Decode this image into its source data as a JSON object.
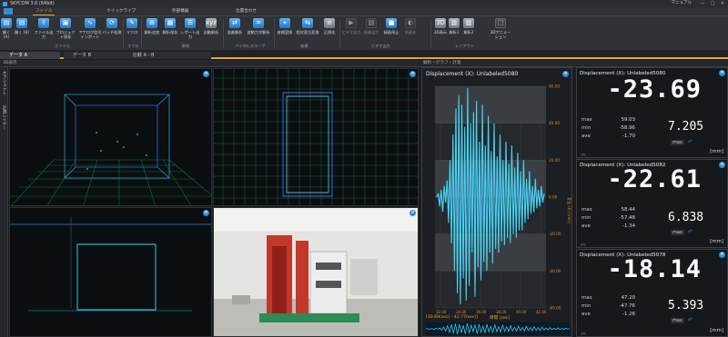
{
  "window": {
    "title": "SKYCOM 3.6 (64bit)",
    "right_label": "マニュアル",
    "min": "—",
    "max": "□",
    "close": "✕"
  },
  "ribbon_tabs": [
    {
      "label": "ファイル",
      "active": true
    },
    {
      "label": "クイックライブ",
      "active": false
    },
    {
      "label": "外部機器",
      "active": false
    },
    {
      "label": "位置合わせ",
      "active": false
    }
  ],
  "ribbon": {
    "buttons": [
      {
        "label": "開く (A)",
        "icon": "folder-icon"
      },
      {
        "label": "開く (B)",
        "icon": "folder-icon"
      },
      {
        "label": "ファイル出力",
        "icon": "export-icon"
      },
      {
        "label": "プロジェクト保存",
        "icon": "save-icon"
      },
      {
        "label": "アナログ信号インポート",
        "icon": "import-icon"
      },
      {
        "label": "バッチ処理",
        "icon": "batch-icon"
      },
      {
        "label": "マクロ",
        "icon": "macro-icon"
      },
      {
        "label": "解析追加",
        "icon": "add-analysis-icon"
      },
      {
        "label": "解析保存",
        "icon": "save-analysis-icon"
      },
      {
        "label": "レポート出力",
        "icon": "report-icon"
      },
      {
        "label": "自動解析",
        "icon": "auto-analysis-icon"
      },
      {
        "label": "並進解析",
        "icon": "translation-icon"
      },
      {
        "label": "波動力学解析",
        "icon": "wave-icon"
      },
      {
        "label": "座標変換",
        "icon": "coordinate-icon"
      },
      {
        "label": "相対変位変換",
        "icon": "relative-icon"
      },
      {
        "label": "正規化",
        "icon": "normalize-icon"
      },
      {
        "label": "ビデオ出力",
        "icon": "video-out-icon"
      },
      {
        "label": "画像出力",
        "icon": "image-out-icon"
      },
      {
        "label": "録画停止",
        "icon": "record-stop-icon"
      },
      {
        "label": "低速化",
        "icon": "slow-icon"
      },
      {
        "label": "3D表示",
        "icon": "3d-icon"
      },
      {
        "label": "解析1",
        "icon": "layout-1-icon"
      },
      {
        "label": "解析2",
        "icon": "layout-2-icon"
      },
      {
        "label": "3Dアニメーション",
        "icon": "3d-animation-icon"
      }
    ],
    "groups": [
      "ファイル",
      "マクロ",
      "解析",
      "バイタルスコープ",
      "座標",
      "ビデオ出力",
      "レイアウト"
    ]
  },
  "doc_tabs": [
    {
      "label": "データ A",
      "active": true
    },
    {
      "label": "データ B",
      "active": false
    },
    {
      "label": "比較 A・B",
      "active": false
    }
  ],
  "subheader": {
    "left": "3D表示",
    "right": "解析・グラフ・計測"
  },
  "side_strip": {
    "items": [
      "オブジェクト",
      "計測レイヤー"
    ]
  },
  "chart_data": {
    "type": "line",
    "title": "Displacement (X): Unlabeled5080",
    "ylabel": "変位 (X) [mm]",
    "xlabel": "時間 [sec]",
    "ylim": [
      -60,
      60
    ],
    "xlim": [
      32,
      43
    ],
    "y_ticks": [
      "60.00",
      "40.00",
      "20.00",
      "0.00",
      "-20.00",
      "-40.00",
      "-60.00"
    ],
    "x_ticks": [
      "32.00",
      "34.00",
      "36.00",
      "38.00",
      "40.00",
      "42.00"
    ],
    "cursor_text": "[30.69(sec) - 42.77(sec)]",
    "series": [
      {
        "color": "#3fd8ee",
        "values": [
          0,
          2,
          -5,
          4,
          -8,
          6,
          -3,
          9,
          -14,
          20,
          -25,
          34,
          -40,
          48,
          -52,
          55,
          -58,
          50,
          -44,
          38,
          -56,
          59,
          -48,
          40,
          -30,
          46,
          -54,
          52,
          -38,
          30,
          -45,
          50,
          -35,
          28,
          -40,
          44,
          -30,
          25,
          -36,
          40,
          -28,
          22,
          -30,
          34,
          -24,
          20,
          -26,
          30,
          -22,
          18,
          -25,
          28,
          -20,
          16,
          -22,
          24,
          -18,
          14,
          -18,
          20,
          -14,
          10,
          -12,
          14,
          -9,
          6,
          -8,
          10,
          -6,
          4,
          -5,
          6,
          -3,
          2
        ]
      },
      {
        "color": "#9a3ae0",
        "values": [
          0,
          1,
          -4,
          3,
          -7,
          5,
          -2,
          8,
          -12,
          18,
          -22,
          31,
          -37,
          45,
          -49,
          52,
          -55,
          47,
          -41,
          35,
          -53,
          56,
          -45,
          37,
          -27,
          43,
          -51,
          49,
          -35,
          27,
          -42,
          47,
          -32,
          25,
          -37,
          41,
          -27,
          22,
          -33,
          37,
          -25,
          19,
          -27,
          31,
          -21,
          17,
          -23,
          27,
          -19,
          15,
          -22,
          25,
          -17,
          13,
          -19,
          21,
          -15,
          11,
          -15,
          17,
          -11,
          7,
          -9,
          11,
          -6,
          3,
          -5,
          7,
          -3,
          1,
          -2,
          3,
          -1,
          1
        ]
      }
    ]
  },
  "readouts": [
    {
      "title": "Displacement (X): Unlabeled5080",
      "big": "-23.69",
      "max": "59.03",
      "min": "-58.96",
      "ave": "-1.70",
      "small": "7.205",
      "mode": "max",
      "unit": "[mm]"
    },
    {
      "title": "Displacement (X): Unlabeled5082",
      "big": "-22.61",
      "max": "58.44",
      "min": "-57.48",
      "ave": "-1.34",
      "small": "6.838",
      "mode": "max",
      "unit": "[mm]"
    },
    {
      "title": "Displacement (X): Unlabeled5078",
      "big": "-18.14",
      "max": "47.20",
      "min": "-47.76",
      "ave": "-1.26",
      "small": "5.393",
      "mode": "max",
      "unit": "[mm]"
    }
  ],
  "labels": {
    "max": "max",
    "min": "min",
    "ave": "ave"
  },
  "colors": {
    "accent": "#f0a030",
    "blue": "#2f8fd8",
    "cyan": "#3fd8ee",
    "purple": "#9a3ae0",
    "grid": "#1e6f3a"
  }
}
